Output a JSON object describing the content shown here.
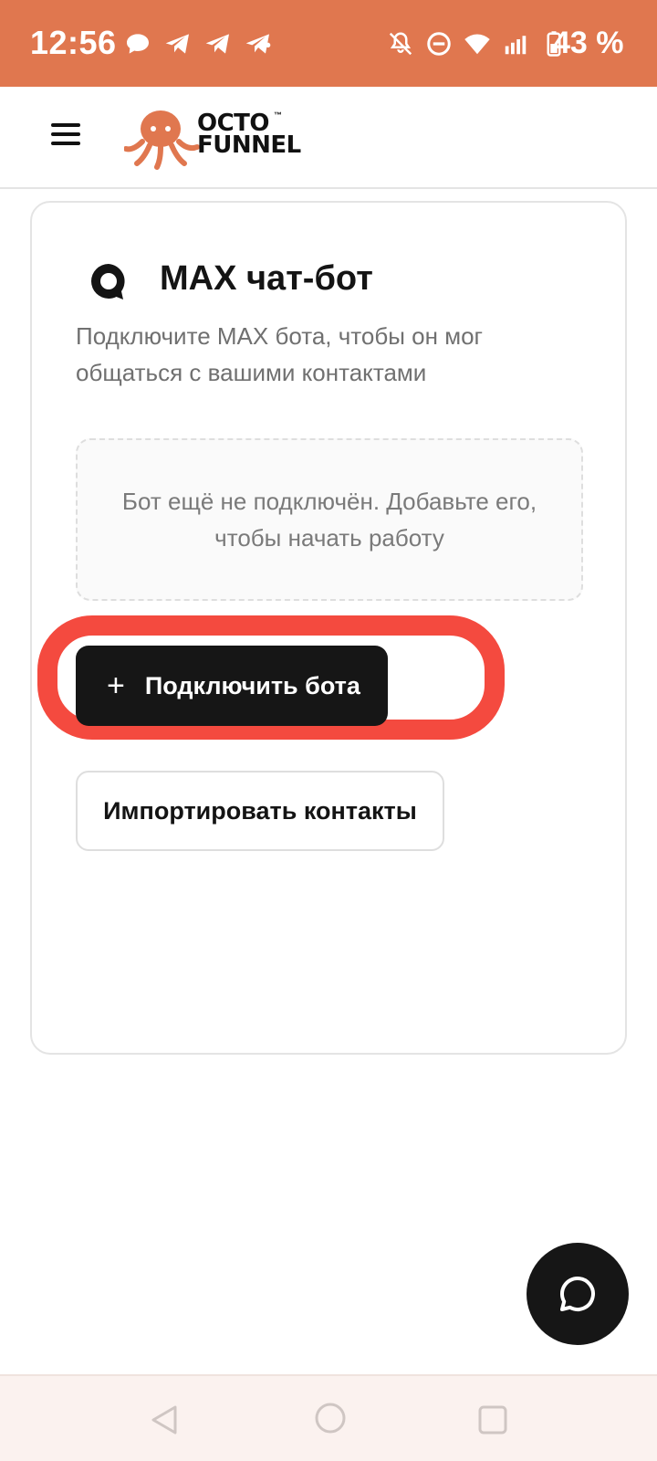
{
  "status_bar": {
    "time": "12:56",
    "battery_text": "43 %",
    "icons": [
      "chat-bubble-icon",
      "telegram-icon",
      "telegram-icon",
      "telegram-icon",
      "bell-off-icon",
      "do-not-disturb-icon",
      "wifi-icon",
      "signal-icon",
      "battery-icon"
    ]
  },
  "header": {
    "logo_line1": "OCTO",
    "logo_line2": "FUNNEL",
    "logo_tm": "™",
    "menu_icon": "hamburger-icon"
  },
  "card": {
    "title": "MAX чат-бот",
    "description": "Подключите MAX бота, чтобы он мог общаться с вашими контактами",
    "empty_state": "Бот ещё не подключён. Добавьте его, чтобы начать работу",
    "connect_button": {
      "icon": "+",
      "label": "Подключить бота"
    },
    "import_button": {
      "label": "Импортировать контакты"
    }
  },
  "colors": {
    "status_bar": "#e0774f",
    "brand_octopus": "#e0774f",
    "highlight": "#f44a3f",
    "button_dark": "#161616"
  },
  "nav": {
    "icons": [
      "back-icon",
      "home-icon",
      "recent-apps-icon"
    ]
  }
}
